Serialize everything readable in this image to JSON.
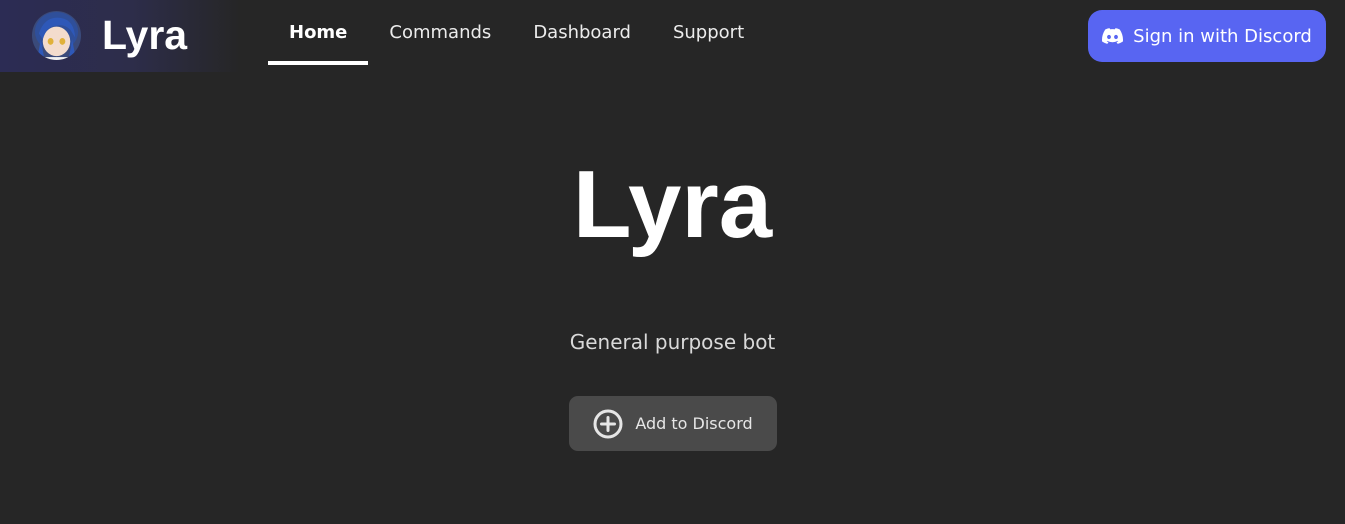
{
  "brand": {
    "name": "Lyra",
    "avatar_icon": "anime-avatar-icon"
  },
  "nav": {
    "items": [
      {
        "label": "Home",
        "active": true
      },
      {
        "label": "Commands",
        "active": false
      },
      {
        "label": "Dashboard",
        "active": false
      },
      {
        "label": "Support",
        "active": false
      }
    ]
  },
  "signin": {
    "label": "Sign in with Discord",
    "icon": "discord-icon",
    "color": "#5865f2"
  },
  "hero": {
    "title": "Lyra",
    "subtitle": "General purpose bot"
  },
  "add_button": {
    "label": "Add to Discord",
    "icon": "plus-circle-icon"
  },
  "colors": {
    "background": "#262626",
    "brand_band": "#2c2c54",
    "button_gray": "#4a4a4a"
  }
}
